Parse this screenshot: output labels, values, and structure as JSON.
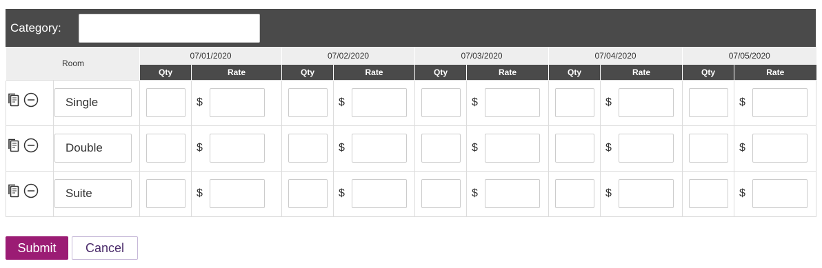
{
  "category": {
    "label": "Category:",
    "value": ""
  },
  "table": {
    "room_header": "Room",
    "qty_label": "Qty",
    "rate_label": "Rate",
    "currency_symbol": "$",
    "dates": [
      "07/01/2020",
      "07/02/2020",
      "07/03/2020",
      "07/04/2020",
      "07/05/2020"
    ],
    "rows": [
      {
        "room": "Single"
      },
      {
        "room": "Double"
      },
      {
        "room": "Suite"
      }
    ],
    "row_icons": [
      "copy-icon",
      "remove-circle-icon"
    ]
  },
  "buttons": {
    "submit": "Submit",
    "cancel": "Cancel"
  },
  "colors": {
    "header_bg": "#4a4a4a",
    "subheader_bg": "#eeeeee",
    "submit_bg": "#9b1c74"
  }
}
